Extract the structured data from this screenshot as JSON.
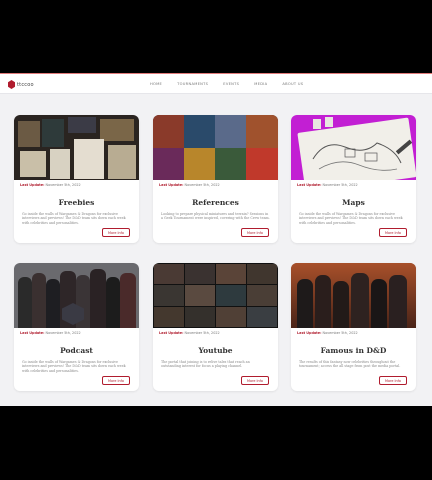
{
  "nav": {
    "logo_text": "ttccoo",
    "links": [
      "HOME",
      "TOURNAMENTS",
      "EVENTS",
      "MEDIA",
      "ABOUT US"
    ]
  },
  "cards": [
    {
      "date_label": "Last Update:",
      "date_value": "November 5th, 2022",
      "title": "Freebies",
      "description": "Go inside the walls of Wargames & Dragons for exclusive interviews and previews! The D&D team sits down each week with celebrities and personalities.",
      "button": "More Info"
    },
    {
      "date_label": "Last Update:",
      "date_value": "November 5th, 2022",
      "title": "References",
      "description": "Looking to prepare physical miniatures and terrain? Sessions in a Geek Tournament were inspired, covering with the Crew team.",
      "button": "More Info"
    },
    {
      "date_label": "Last Update:",
      "date_value": "November 5th, 2022",
      "title": "Maps",
      "description": "Go inside the walls of Wargames & Dragons for exclusive interviews and previews! The D&D team sits down each week with celebrities and personalities.",
      "button": "More Info"
    },
    {
      "date_label": "Last Update:",
      "date_value": "November 5th, 2022",
      "title": "Podcast",
      "description": "Go inside the walls of Wargames & Dragons for exclusive interviews and previews! The D&D team sits down each week with celebrities and personalities.",
      "button": "More Info"
    },
    {
      "date_label": "Last Update:",
      "date_value": "November 5th, 2022",
      "title": "Youtube",
      "description": "The portal that joining is to relive tales that reach an outstanding interest for focus a playing channel.",
      "button": "More Info"
    },
    {
      "date_label": "Last Update:",
      "date_value": "November 5th, 2022",
      "title": "Famous in D&D",
      "description": "The results of this fantasy now celebrities throughout the tournament; access the all stage from post the media portal.",
      "button": "More Info"
    }
  ],
  "colors": {
    "accent": "#b01c2e",
    "page_bg": "#f2f2f4",
    "maps_bg": "#c21fd3"
  }
}
